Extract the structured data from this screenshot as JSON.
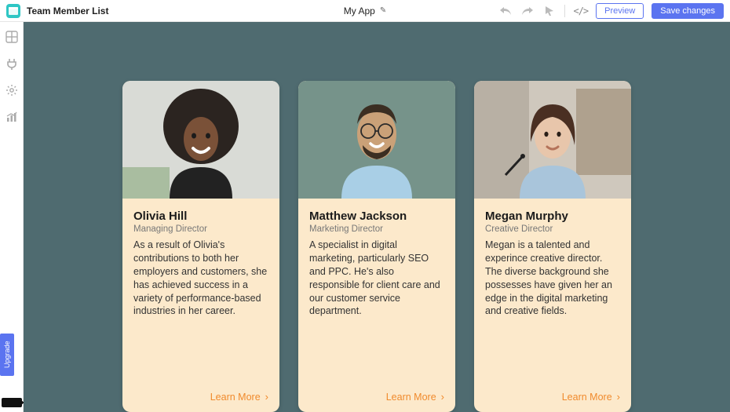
{
  "header": {
    "page_title": "Team Member List",
    "app_name": "My App",
    "preview_label": "Preview",
    "save_label": "Save changes"
  },
  "sidebar": {
    "upgrade_label": "Upgrade"
  },
  "cards": [
    {
      "name": "Olivia Hill",
      "role": "Managing Director",
      "bio": "As a result of Olivia's contributions to both her employers and customers, she has achieved success in a variety of performance-based industries in her career.",
      "link_label": "Learn More"
    },
    {
      "name": "Matthew Jackson",
      "role": "Marketing Director",
      "bio": "A specialist in digital marketing, particularly SEO and PPC. He's also responsible for client care and our customer service department.",
      "link_label": "Learn More"
    },
    {
      "name": "Megan Murphy",
      "role": "Creative Director",
      "bio": "Megan is a talented and experince creative director. The diverse background she possesses have given her an edge in the digital marketing and creative fields.",
      "link_label": "Learn More"
    }
  ]
}
